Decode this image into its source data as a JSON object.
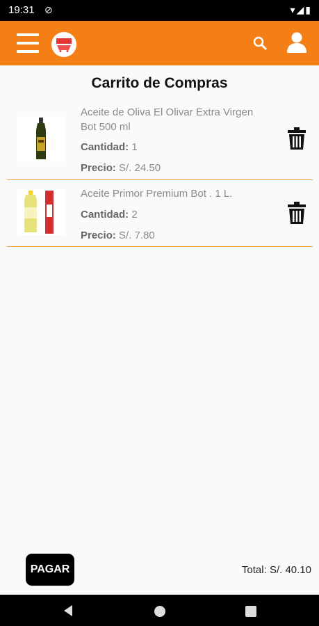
{
  "status_bar": {
    "time": "19:31",
    "sync_icon": "sync-icon",
    "icons": "wifi signal battery"
  },
  "app_bar": {
    "accent_color": "#f57f17",
    "menu_icon": "hamburger-menu-icon",
    "logo_icon": "store-cart-logo",
    "search_icon": "search-icon",
    "user_icon": "user-icon"
  },
  "page": {
    "title": "Carrito de Compras"
  },
  "cart": {
    "items": [
      {
        "name": "Aceite de Oliva El Olivar Extra Virgen Bot 500 ml",
        "qty_label": "Cantidad:",
        "qty": "1",
        "price_label": "Precio:",
        "price": "S/. 24.50",
        "image_icon": "olive-oil-bottle-image"
      },
      {
        "name": "Aceite Primor Premium Bot . 1 L.",
        "qty_label": "Cantidad:",
        "qty": "2",
        "price_label": "Precio:",
        "price": "S/. 7.80",
        "image_icon": "vegetable-oil-bottle-image"
      }
    ],
    "delete_icon": "trash-icon"
  },
  "footer": {
    "pay_label": "PAGAR",
    "total": "Total: S/. 40.10"
  },
  "nav": {
    "back_icon": "back-triangle-icon",
    "home_icon": "home-circle-icon",
    "recents_icon": "recents-square-icon"
  }
}
